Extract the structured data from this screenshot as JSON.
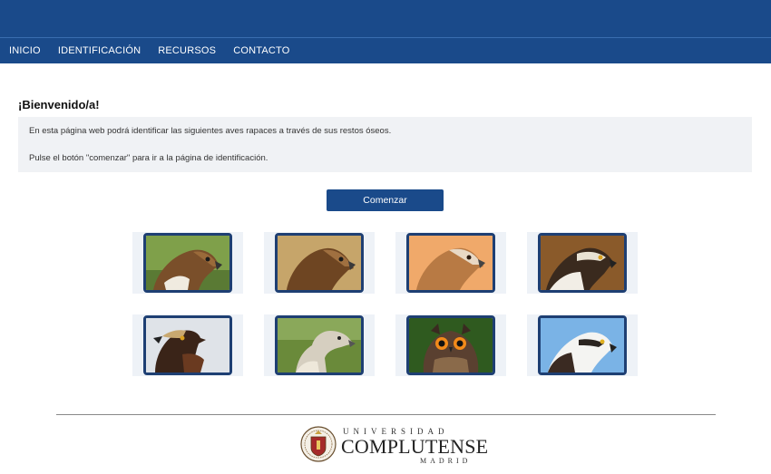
{
  "nav": {
    "items": [
      "INICIO",
      "IDENTIFICACIÓN",
      "RECURSOS",
      "CONTACTO"
    ]
  },
  "welcome": {
    "title": "¡Bienvenido/a!",
    "line1": "En esta página web podrá identificar las siguientes aves rapaces a través de sus restos óseos.",
    "line2": "Pulse el botón \"comenzar\" para ir a la página de identificación."
  },
  "start_button": {
    "label": "Comenzar"
  },
  "footer": {
    "logo_top": "UNIVERSIDAD",
    "logo_main": "COMPLUTENSE",
    "logo_bottom": "MADRID"
  },
  "colors": {
    "brand_blue": "#1a4a8a",
    "frame_border": "#1e3f73"
  }
}
